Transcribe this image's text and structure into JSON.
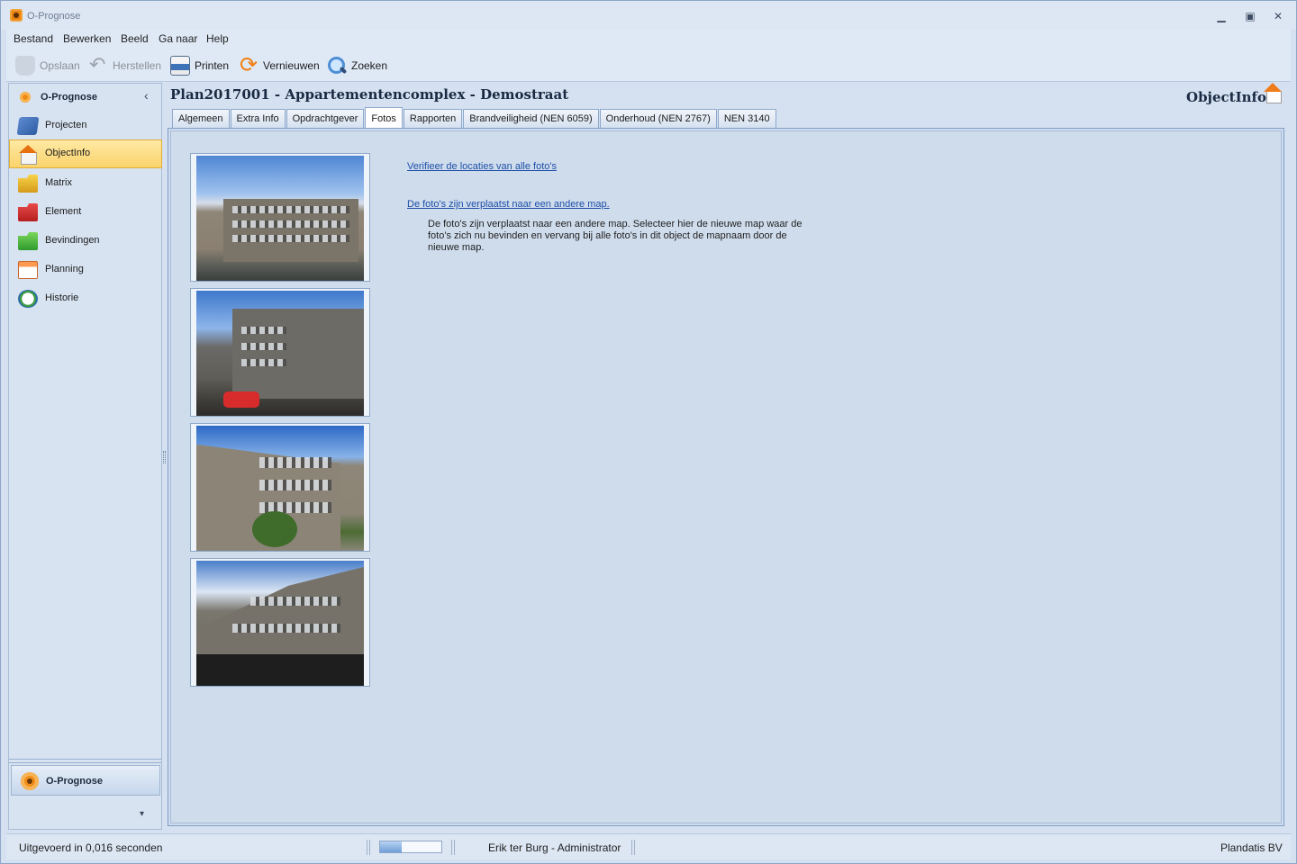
{
  "window": {
    "title": "O-Prognose"
  },
  "menu": [
    "Bestand",
    "Bewerken",
    "Beeld",
    "Ga naar",
    "Help"
  ],
  "toolbar": {
    "save": "Opslaan",
    "restore": "Herstellen",
    "print": "Printen",
    "refresh": "Vernieuwen",
    "search": "Zoeken"
  },
  "nav": {
    "header": "O-Prognose",
    "items": [
      {
        "label": "Projecten",
        "icon": "projects-icon"
      },
      {
        "label": "ObjectInfo",
        "icon": "house-icon"
      },
      {
        "label": "Matrix",
        "icon": "yellow-folder-icon"
      },
      {
        "label": "Element",
        "icon": "red-folder-icon"
      },
      {
        "label": "Bevindingen",
        "icon": "green-folder-icon"
      },
      {
        "label": "Planning",
        "icon": "calendar-icon"
      },
      {
        "label": "Historie",
        "icon": "history-icon"
      }
    ],
    "selected": "ObjectInfo",
    "bottom_button": "O-Prognose"
  },
  "page": {
    "title": "Plan2017001 - Appartementencomplex - Demostraat",
    "module": "ObjectInfo"
  },
  "tabs": [
    "Algemeen",
    "Extra Info",
    "Opdrachtgever",
    "Fotos",
    "Rapporten",
    "Brandveiligheid (NEN 6059)",
    "Onderhoud (NEN 2767)",
    "NEN 3140"
  ],
  "active_tab": "Fotos",
  "fotos": {
    "verify_link": "Verifieer de locaties van alle foto's",
    "moved_link": "De foto's zijn verplaatst naar een andere map.",
    "moved_description": "De foto's zijn verplaatst naar een andere map. Selecteer hier de nieuwe map waar de foto's zich nu bevinden en vervang bij alle foto's in dit object de mapnaam door de nieuwe map."
  },
  "status": {
    "executed": "Uitgevoerd in 0,016 seconden",
    "progress": 0.35,
    "user": "Erik ter Burg - Administrator",
    "company": "Plandatis BV"
  },
  "colors": {
    "selected_nav": "#fbd36c",
    "link": "#1d4fa8",
    "accent": "#e8830f"
  }
}
